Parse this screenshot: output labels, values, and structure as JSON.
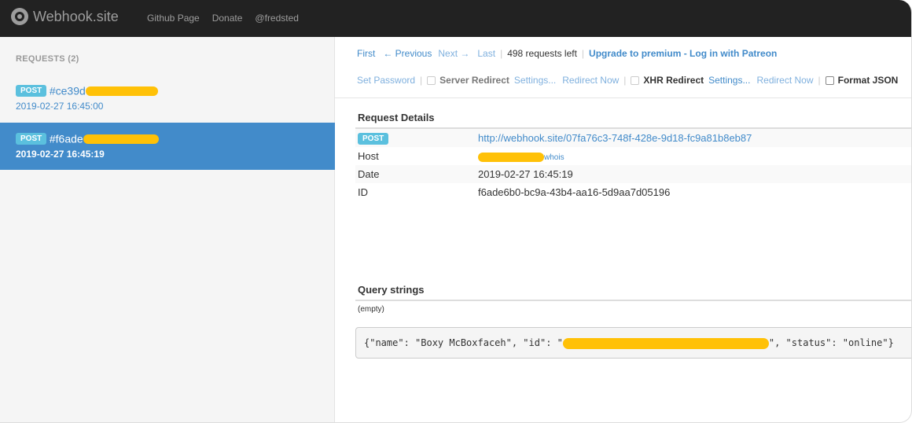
{
  "navbar": {
    "brand": "Webhook.site",
    "links": [
      "Github Page",
      "Donate",
      "@fredsted"
    ]
  },
  "sidebar": {
    "header": "REQUESTS (2)",
    "requests": [
      {
        "method": "POST",
        "id": "#ce39d",
        "time": "2019-02-27 16:45:00",
        "active": false
      },
      {
        "method": "POST",
        "id": "#f6ade",
        "time": "2019-02-27 16:45:19",
        "active": true
      }
    ]
  },
  "toolbar": {
    "first": "First",
    "previous": "← Previous",
    "next": "Next →",
    "last": "Last",
    "requests_left": "498 requests left",
    "upgrade": "Upgrade to premium - Log in with Patreon",
    "set_password": "Set Password",
    "server_redirect": "Server Redirect",
    "settings1": "Settings...",
    "redirect_now1": "Redirect Now",
    "xhr_redirect": "XHR Redirect",
    "settings2": "Settings...",
    "redirect_now2": "Redirect Now",
    "format_json": "Format JSON"
  },
  "details": {
    "title": "Request Details",
    "method": "POST",
    "url": "http://webhook.site/07fa76c3-748f-428e-9d18-fc9a81b8eb87",
    "host_label": "Host",
    "whois": "whois",
    "date_label": "Date",
    "date": "2019-02-27 16:45:19",
    "id_label": "ID",
    "id": "f6ade6b0-bc9a-43b4-aa16-5d9aa7d05196"
  },
  "query": {
    "title": "Query strings",
    "empty": "(empty)"
  },
  "body": {
    "prefix": "{\"name\": \"Boxy McBoxfaceh\", \"id\": \"",
    "suffix": "\", \"status\": \"online\"}"
  },
  "colors": {
    "navbar": "#222222",
    "link": "#428bca",
    "active_item": "#428bca",
    "badge": "#5bc0de",
    "redaction": "#ffc107"
  }
}
